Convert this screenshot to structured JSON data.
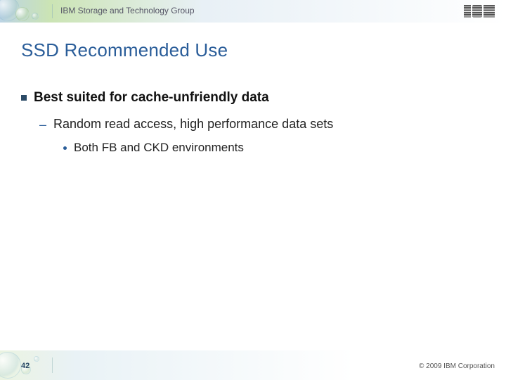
{
  "banner": {
    "org": "IBM Storage and Technology Group",
    "logo_alt": "IBM"
  },
  "title": "SSD Recommended Use",
  "bullets": {
    "l1": "Best suited for cache-unfriendly data",
    "l2": "Random read access, high performance data sets",
    "l3": "Both FB and CKD environments"
  },
  "footer": {
    "slide_number": "42",
    "copyright": "© 2009 IBM Corporation"
  }
}
